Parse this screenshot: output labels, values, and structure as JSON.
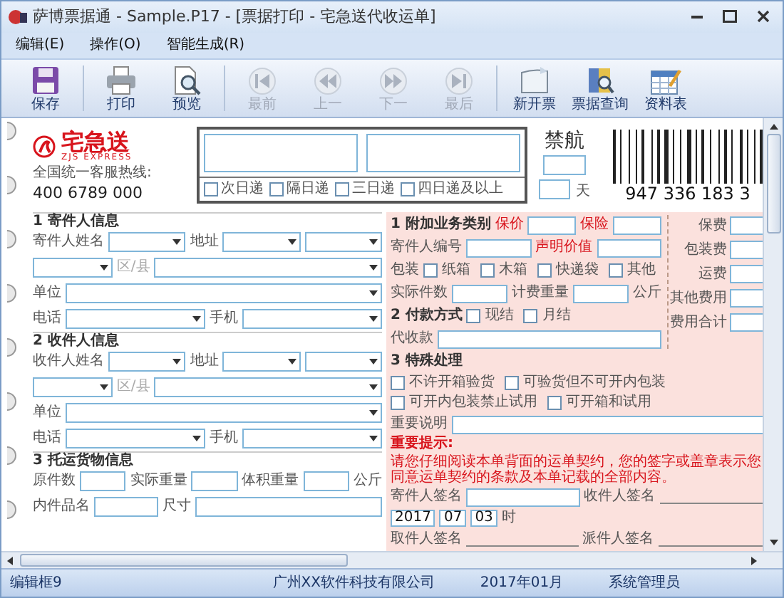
{
  "window": {
    "title": "萨博票据通 - Sample.P17 - [票据打印 - 宅急送代收运单]"
  },
  "menu": [
    "编辑(E)",
    "操作(O)",
    "智能生成(R)"
  ],
  "toolbar": [
    {
      "label": "保存",
      "disabled": false
    },
    {
      "label": "打印",
      "disabled": false
    },
    {
      "label": "预览",
      "disabled": false
    },
    {
      "label": "最前",
      "disabled": true
    },
    {
      "label": "上一",
      "disabled": true
    },
    {
      "label": "下一",
      "disabled": true
    },
    {
      "label": "最后",
      "disabled": true
    },
    {
      "label": "新开票",
      "disabled": false
    },
    {
      "label": "票据查询",
      "disabled": false
    },
    {
      "label": "资料表",
      "disabled": false
    }
  ],
  "waybill": {
    "brand": {
      "name": "宅急送",
      "tagline": "ZJS EXPRESS",
      "hotline_label": "全国统一客服热线:",
      "hotline": "400 6789 000"
    },
    "delivery_options": [
      {
        "label": "次日递",
        "checked": false
      },
      {
        "label": "隔日递",
        "checked": false
      },
      {
        "label": "三日递",
        "checked": false
      },
      {
        "label": "四日递及以上",
        "checked": false
      }
    ],
    "restriction": {
      "label": "禁航",
      "unit": "天"
    },
    "tracking_number": "947 336 183 3",
    "left_sections": [
      {
        "title": "1 寄件人信息",
        "rows": [
          [
            {
              "kind": "label",
              "text": "寄件人姓名"
            },
            {
              "kind": "select"
            },
            {
              "kind": "label",
              "text": "地址"
            },
            {
              "kind": "select"
            },
            {
              "kind": "select"
            }
          ],
          [
            {
              "kind": "select"
            },
            {
              "kind": "hint",
              "text": "区/县"
            },
            {
              "kind": "wide-select"
            }
          ],
          [
            {
              "kind": "label",
              "text": "单位"
            },
            {
              "kind": "wide-select"
            }
          ],
          [
            {
              "kind": "label",
              "text": "电话"
            },
            {
              "kind": "select"
            },
            {
              "kind": "label",
              "text": "手机"
            },
            {
              "kind": "select"
            }
          ]
        ]
      },
      {
        "title": "2 收件人信息",
        "rows": [
          [
            {
              "kind": "label",
              "text": "收件人姓名"
            },
            {
              "kind": "select"
            },
            {
              "kind": "label",
              "text": "地址"
            },
            {
              "kind": "select"
            },
            {
              "kind": "select"
            }
          ],
          [
            {
              "kind": "select"
            },
            {
              "kind": "hint",
              "text": "区/县"
            },
            {
              "kind": "wide-select"
            }
          ],
          [
            {
              "kind": "label",
              "text": "单位"
            },
            {
              "kind": "wide-select"
            }
          ],
          [
            {
              "kind": "label",
              "text": "电话"
            },
            {
              "kind": "select"
            },
            {
              "kind": "label",
              "text": "手机"
            },
            {
              "kind": "select"
            }
          ]
        ]
      },
      {
        "title": "3 托运货物信息",
        "rows": [
          [
            {
              "kind": "label",
              "text": "原件数"
            },
            {
              "kind": "input"
            },
            {
              "kind": "label",
              "text": "实际重量"
            },
            {
              "kind": "input"
            },
            {
              "kind": "label",
              "text": "体积重量"
            },
            {
              "kind": "input"
            },
            {
              "kind": "label",
              "text": "公斤"
            }
          ],
          [
            {
              "kind": "label",
              "text": "内件品名"
            },
            {
              "kind": "input"
            },
            {
              "kind": "label",
              "text": "尺寸"
            },
            {
              "kind": "wide-input"
            }
          ]
        ]
      }
    ],
    "right_rows": [
      [
        {
          "kind": "heading",
          "text": "1 附加业务类别"
        },
        {
          "kind": "red-label",
          "text": "保价"
        },
        {
          "kind": "input"
        },
        {
          "kind": "red-label",
          "text": "保险"
        },
        {
          "kind": "input"
        }
      ],
      [
        {
          "kind": "label",
          "text": "寄件人编号"
        },
        {
          "kind": "input"
        },
        {
          "kind": "red-label",
          "text": "声明价值"
        },
        {
          "kind": "input"
        }
      ],
      [
        {
          "kind": "label",
          "text": "包装"
        },
        {
          "kind": "check",
          "text": "纸箱",
          "checked": false
        },
        {
          "kind": "check",
          "text": "木箱",
          "checked": false
        },
        {
          "kind": "check",
          "text": "快递袋",
          "checked": false
        },
        {
          "kind": "check",
          "text": "其他",
          "checked": false
        }
      ],
      [
        {
          "kind": "label",
          "text": "实际件数"
        },
        {
          "kind": "input"
        },
        {
          "kind": "label",
          "text": "计费重量"
        },
        {
          "kind": "input"
        },
        {
          "kind": "label",
          "text": "公斤"
        }
      ],
      [
        {
          "kind": "heading",
          "text": "2 付款方式"
        },
        {
          "kind": "check",
          "text": "现结",
          "checked": false
        },
        {
          "kind": "check",
          "text": "月结",
          "checked": false
        }
      ],
      [
        {
          "kind": "label",
          "text": "代收款"
        },
        {
          "kind": "input"
        }
      ]
    ],
    "fees": [
      "保费",
      "包装费",
      "运费",
      "其他费用",
      "费用合计"
    ],
    "special_rows": [
      [
        {
          "kind": "heading",
          "text": "3 特殊处理"
        }
      ],
      [
        {
          "kind": "check",
          "text": "不许开箱验货",
          "checked": false
        },
        {
          "kind": "check",
          "text": "可验货但不可开内包装",
          "checked": false
        }
      ],
      [
        {
          "kind": "check",
          "text": "可开内包装禁止试用",
          "checked": false
        },
        {
          "kind": "check",
          "text": "可开箱和试用",
          "checked": false
        }
      ],
      [
        {
          "kind": "label",
          "text": "重要说明"
        },
        {
          "kind": "wide-input"
        }
      ]
    ],
    "notice": {
      "title": "重要提示:",
      "text": "请您仔细阅读本单背面的运单契约，您的签字或盖章表示您同意运单契约的条款及本单记载的全部内容。"
    },
    "signature_rows": [
      [
        {
          "kind": "label",
          "text": "寄件人签名"
        },
        {
          "kind": "input"
        },
        {
          "kind": "label",
          "text": "收件人签名"
        },
        {
          "kind": "line"
        }
      ],
      [
        {
          "kind": "value",
          "text": "2017"
        },
        {
          "kind": "value",
          "text": "07"
        },
        {
          "kind": "value",
          "text": "03"
        },
        {
          "kind": "label",
          "text": "时"
        }
      ],
      [
        {
          "kind": "label",
          "text": "取件人签名"
        },
        {
          "kind": "line"
        },
        {
          "kind": "label",
          "text": "派件人签名"
        },
        {
          "kind": "line"
        }
      ]
    ]
  },
  "status_bar": [
    "编辑框9",
    "广州XX软件科技有限公司",
    "2017年01月",
    "系统管理员"
  ]
}
